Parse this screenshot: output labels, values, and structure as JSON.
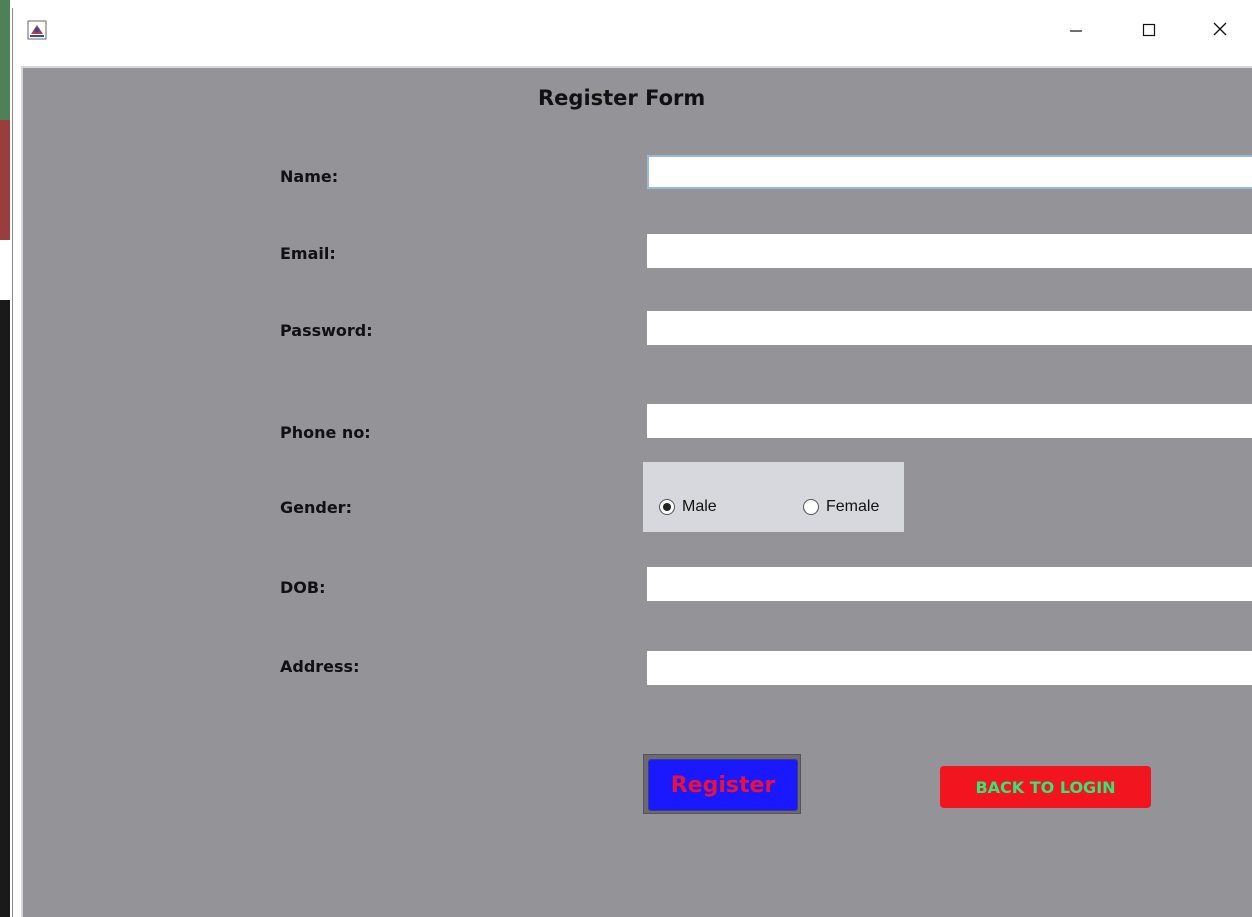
{
  "window": {
    "icon": "java-app-icon",
    "controls": {
      "minimize": "minimize-icon",
      "maximize": "maximize-icon",
      "close": "close-icon"
    }
  },
  "form": {
    "title": "Register Form",
    "labels": {
      "name": "Name:",
      "email": "Email:",
      "password": "Password:",
      "phone": "Phone no:",
      "gender": "Gender:",
      "dob": "DOB:",
      "address": "Address:"
    },
    "values": {
      "name": "",
      "email": "",
      "password": "",
      "phone": "",
      "dob": "",
      "address": ""
    },
    "gender": {
      "options": [
        "Male",
        "Female"
      ],
      "selected": "Male"
    },
    "buttons": {
      "register": "Register",
      "back_to_login": "BACK TO LOGIN"
    }
  },
  "colors": {
    "background": "#939398",
    "register_bg": "#1a18ff",
    "register_text": "#e8123c",
    "back_bg": "#f2141e",
    "back_text": "#30e878"
  }
}
